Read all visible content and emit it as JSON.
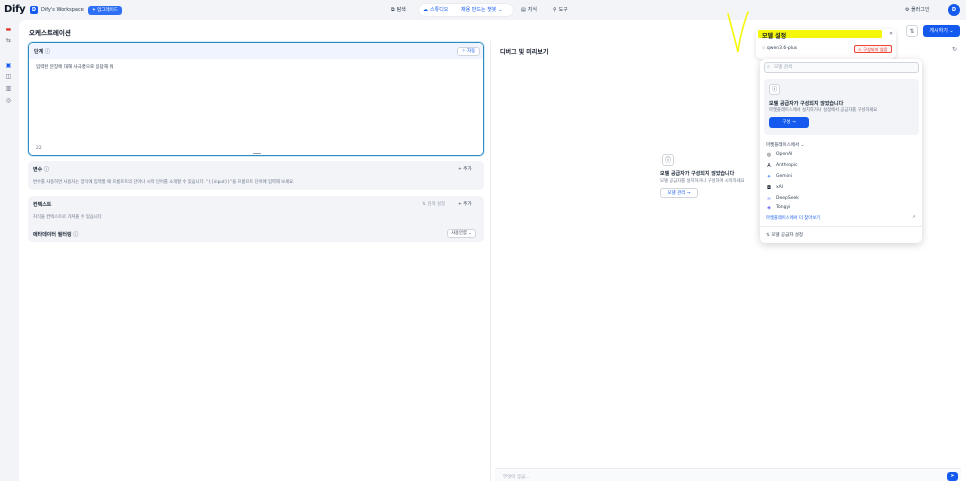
{
  "topbar": {
    "logo": "Dify",
    "workspace_initial": "D",
    "workspace_name": "Dify's Workspace",
    "plan_badge": "✦ 업그레이드",
    "nav": [
      {
        "label": "탐색",
        "icon": "explore-icon"
      },
      {
        "label": "스튜디오",
        "icon": "studio-icon"
      },
      {
        "label": "채용 만드는 챗봇",
        "icon": "chevron-down-icon"
      },
      {
        "label": "지식",
        "icon": "knowledge-icon"
      },
      {
        "label": "도구",
        "icon": "tools-icon"
      }
    ],
    "plugins_label": "플러그인",
    "user_initial": "D"
  },
  "page": {
    "title": "오케스트레이션",
    "publish_label": "게시하기 ⌄"
  },
  "prompt": {
    "label": "단계",
    "auto_label": "✧ 자동",
    "text": "입력된 분장에 대해 사극풍으로 응답해 줘",
    "count": "22"
  },
  "variables": {
    "title": "변수",
    "add_label": "+ 추가",
    "desc": "변수를 사용하면 사용자는 양식에 입력할 때 프롬프트의 단어나 시작 단어를 소개할 수 있습니다. \"{{input}}\"을 프롬프트 단어에 입력해 보세요."
  },
  "context": {
    "title": "컨텍스트",
    "recall_label": "⇅ 검색 설정",
    "add_label": "+ 추가",
    "desc": "지식을 컨텍스트로 가져올 수 있습니다"
  },
  "metadata": {
    "title": "메타데이터 필터링",
    "select_value": "사용안함 ⌄"
  },
  "debug": {
    "title": "디버그 및 미리보기",
    "empty_title": "모델 공급자가 구성되지 않았습니다",
    "empty_desc": "모델 공급자를 설치하거나 구성하여 시작하세요",
    "empty_btn": "모델 관리 →",
    "chat_placeholder": "무엇이 궁금..."
  },
  "model_settings": {
    "title": "모델 설정",
    "model_name": "qwen3.6-plus",
    "warn_badge": "⚠ 구성되지 않음"
  },
  "dropdown": {
    "search_placeholder": "모델 검색",
    "info_title": "모델 공급자가 구성되지 않았습니다",
    "info_desc": "마켓플레이스에서 설치하거나 설정에서 공급자를 구성하세요",
    "info_btn": "구성 →",
    "marketplace_title": "마켓플레이스에서 ⌄",
    "providers": [
      {
        "name": "OpenAI",
        "icon": "openai-icon",
        "glyph": "◎"
      },
      {
        "name": "Anthropic",
        "icon": "anthropic-icon",
        "glyph": "A"
      },
      {
        "name": "Gemini",
        "icon": "gemini-icon",
        "glyph": "✦"
      },
      {
        "name": "xAI",
        "icon": "xai-icon",
        "glyph": "◘"
      },
      {
        "name": "DeepSeek",
        "icon": "deepseek-icon",
        "glyph": "≈"
      },
      {
        "name": "Tongyi",
        "icon": "tongyi-icon",
        "glyph": "◈"
      }
    ],
    "more_link": "마켓플레이스에서 더 찾아보기",
    "footer": "모델 공급자 설정"
  }
}
